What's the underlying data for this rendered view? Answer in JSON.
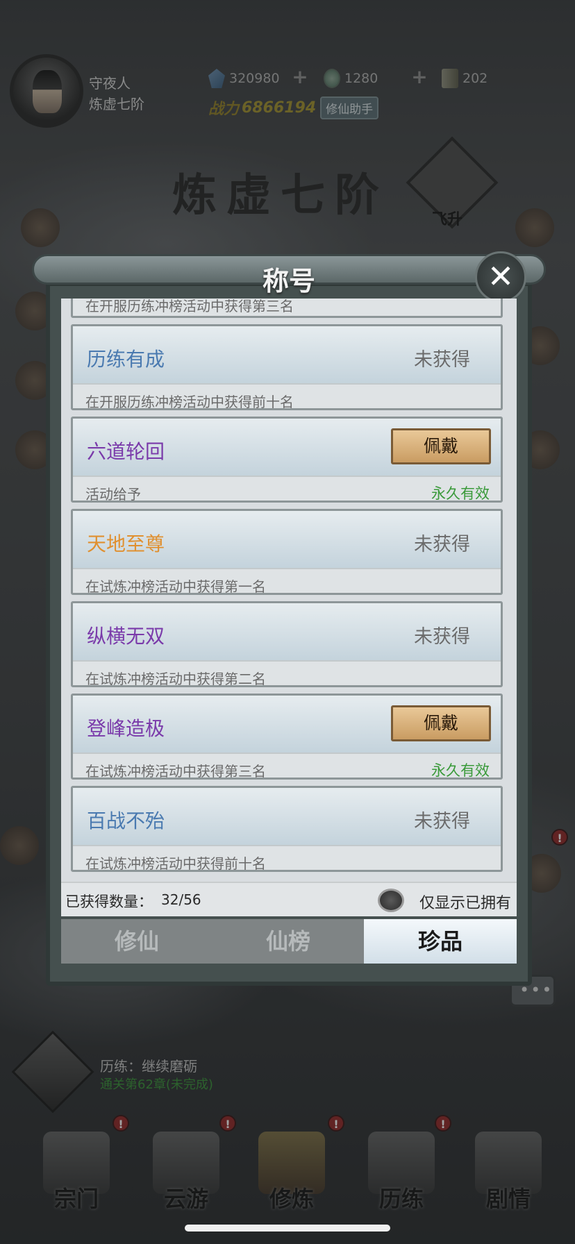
{
  "player": {
    "name": "守夜人",
    "realm": "炼虚七阶"
  },
  "resources": [
    {
      "icon": "spirit-stone-icon",
      "value": "320980"
    },
    {
      "icon": "jade-coin-icon",
      "value": "1280"
    },
    {
      "icon": "scroll-icon",
      "value": "202"
    }
  ],
  "power": {
    "label": "战力",
    "value": "6866194",
    "helper_label": "修仙助手"
  },
  "realm_banner": "炼虚七阶",
  "ascend_label": "飞升",
  "quest": {
    "title": "历练：继续磨砺",
    "subtitle": "通关第62章(未完成)"
  },
  "bottom_nav": [
    {
      "label": "宗门",
      "alert": true
    },
    {
      "label": "云游",
      "alert": true
    },
    {
      "label": "修炼",
      "alert": true,
      "active": true
    },
    {
      "label": "历练",
      "alert": true
    },
    {
      "label": "剧情",
      "alert": false
    }
  ],
  "modal": {
    "title": "称号",
    "close_icon": "close-icon",
    "partial_desc": "在开服历练冲榜活动中获得第三名",
    "titles": [
      {
        "name": "历练有成",
        "color": "blue",
        "status": "未获得",
        "desc": "在开服历练冲榜活动中获得前十名",
        "validity": ""
      },
      {
        "name": "六道轮回",
        "color": "purple",
        "button": "佩戴",
        "desc": "活动给予",
        "validity": "永久有效"
      },
      {
        "name": "天地至尊",
        "color": "orange",
        "status": "未获得",
        "desc": "在试炼冲榜活动中获得第一名",
        "validity": ""
      },
      {
        "name": "纵横无双",
        "color": "purple",
        "status": "未获得",
        "desc": "在试炼冲榜活动中获得第二名",
        "validity": ""
      },
      {
        "name": "登峰造极",
        "color": "purple",
        "button": "佩戴",
        "desc": "在试炼冲榜活动中获得第三名",
        "validity": "永久有效"
      },
      {
        "name": "百战不殆",
        "color": "blue",
        "status": "未获得",
        "desc": "在试炼冲榜活动中获得前十名",
        "validity": ""
      }
    ],
    "count_label": "已获得数量：",
    "count_value": "32/56",
    "toggle_label": "仅显示已拥有",
    "tabs": [
      "修仙",
      "仙榜",
      "珍品"
    ],
    "active_tab": 2
  },
  "colors": {
    "blue": "#4a7ab0",
    "purple": "#7a3aaa",
    "orange": "#e09030",
    "valid_green": "#3a9a3a"
  }
}
